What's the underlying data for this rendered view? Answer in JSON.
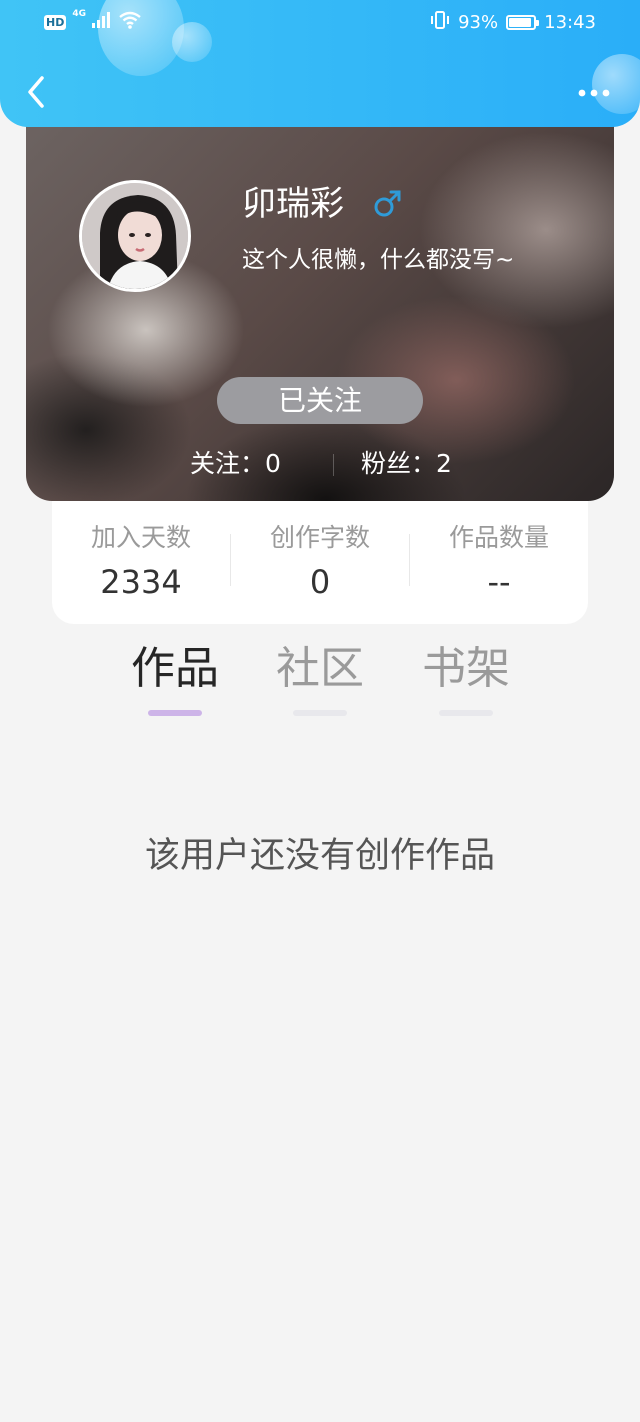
{
  "status_bar": {
    "hd_label": "HD",
    "network_label": "4G",
    "battery_text": "93%",
    "battery_level": 0.93,
    "time": "13:43"
  },
  "header": {
    "back_icon": "chevron-left-icon",
    "more_icon": "more-dots-icon",
    "colors": {
      "gradient_start": "#40c4f6",
      "gradient_end": "#2aaef8"
    }
  },
  "profile": {
    "name": "卯瑞彩",
    "gender_icon": "male-symbol-icon",
    "gender_color": "#2f9bd8",
    "bio": "这个人很懒，什么都没写~",
    "follow_button_label": "已关注",
    "following_label": "关注：",
    "following_count": "0",
    "fans_label": "粉丝：",
    "fans_count": "2"
  },
  "stats": [
    {
      "label": "加入天数",
      "value": "2334"
    },
    {
      "label": "创作字数",
      "value": "0"
    },
    {
      "label": "作品数量",
      "value": "--"
    }
  ],
  "tabs": [
    {
      "label": "作品",
      "active": true
    },
    {
      "label": "社区",
      "active": false
    },
    {
      "label": "书架",
      "active": false
    }
  ],
  "empty_state": {
    "message": "该用户还没有创作作品"
  }
}
